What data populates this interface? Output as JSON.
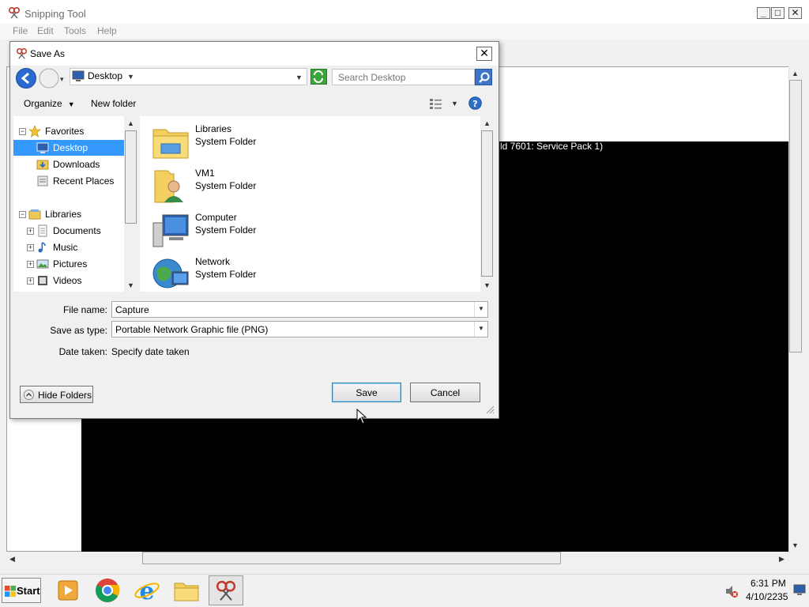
{
  "app": {
    "title": "Snipping Tool",
    "menu": [
      "File",
      "Edit",
      "Tools",
      "Help"
    ],
    "capture_text": "ld 7601: Service Pack 1)"
  },
  "dialog": {
    "title": "Save As",
    "address": "Desktop",
    "search_placeholder": "Search Desktop",
    "toolbar": {
      "organize": "Organize",
      "new_folder": "New folder"
    },
    "nav": {
      "favorites": "Favorites",
      "desktop": "Desktop",
      "downloads": "Downloads",
      "recent": "Recent Places",
      "libraries": "Libraries",
      "documents": "Documents",
      "music": "Music",
      "pictures": "Pictures",
      "videos": "Videos"
    },
    "files": [
      {
        "name": "Libraries",
        "type": "System Folder"
      },
      {
        "name": "VM1",
        "type": "System Folder"
      },
      {
        "name": "Computer",
        "type": "System Folder"
      },
      {
        "name": "Network",
        "type": "System Folder"
      }
    ],
    "file_name_label": "File name:",
    "file_name_value": "Capture",
    "save_type_label": "Save as type:",
    "save_type_value": "Portable Network Graphic file (PNG)",
    "date_label": "Date taken:",
    "date_value": "Specify date taken",
    "hide_folders": "Hide Folders",
    "save": "Save",
    "cancel": "Cancel"
  },
  "taskbar": {
    "start": "Start",
    "time": "6:31 PM",
    "date": "4/10/2235"
  },
  "colors": {
    "selection": "#3399ff",
    "capture_bg": "#000000"
  }
}
